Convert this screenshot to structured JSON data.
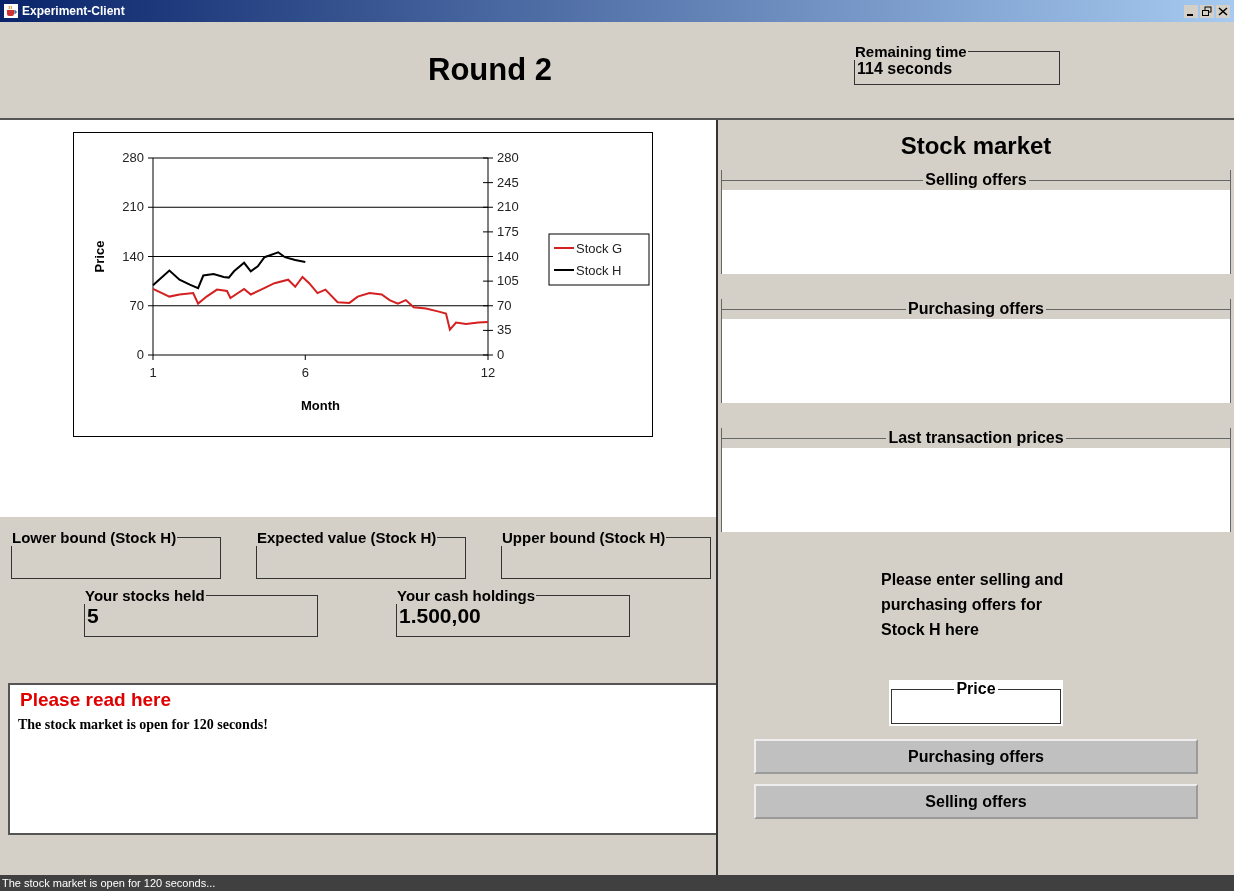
{
  "window": {
    "title": "Experiment-Client"
  },
  "header": {
    "round": "Round 2",
    "remaining_time": {
      "label": "Remaining time",
      "value": "114 seconds"
    }
  },
  "chart_data": {
    "type": "line",
    "xlabel": "Month",
    "ylabel": "Price",
    "xlim": [
      1,
      12
    ],
    "ylim": [
      0,
      280
    ],
    "xticks": [
      1,
      6,
      12
    ],
    "yticks": [
      0,
      70,
      140,
      210,
      280
    ],
    "grid": true,
    "legend": true,
    "annotations": [
      "0",
      "35",
      "70",
      "105",
      "140",
      "175",
      "210",
      "245",
      "280"
    ],
    "series": [
      {
        "name": "Stock G",
        "color": "#d42020",
        "x": [
          1,
          1.54,
          1.87,
          2.32,
          2.48,
          2.76,
          3.1,
          3.43,
          3.54,
          3.99,
          4.21,
          4.55,
          4.99,
          5.44,
          5.67,
          5.91,
          6.13,
          6.4,
          6.66,
          7.06,
          7.45,
          7.72,
          8.11,
          8.51,
          8.77,
          9.04,
          9.3,
          9.56,
          9.96,
          10.35,
          10.62,
          10.75,
          10.95,
          11.28,
          11.68,
          12
        ],
        "values": [
          94,
          83,
          86,
          88,
          73,
          83,
          93,
          91,
          81,
          94,
          86,
          93,
          102,
          107,
          97,
          111,
          102,
          88,
          93,
          75,
          74,
          83,
          88,
          86,
          78,
          73,
          78,
          68,
          66,
          62,
          59,
          36,
          46,
          44,
          46,
          47
        ]
      },
      {
        "name": "Stock H",
        "color": "#000000",
        "x": [
          1,
          1.2,
          1.54,
          1.87,
          2.21,
          2.48,
          2.65,
          2.99,
          3.32,
          3.49,
          3.66,
          3.99,
          4.21,
          4.44,
          4.66,
          5.11,
          5.33,
          5.67,
          6
        ],
        "values": [
          99,
          107,
          120,
          107,
          100,
          95,
          113,
          115,
          111,
          110,
          119,
          131,
          119,
          126,
          139,
          146,
          139,
          135,
          132
        ]
      }
    ]
  },
  "bounds": [
    {
      "label": "Lower bound (Stock H)"
    },
    {
      "label": "Expected value (Stock H)"
    },
    {
      "label": "Upper bound (Stock H)"
    }
  ],
  "holdings": [
    {
      "label": "Your stocks held",
      "value": "5"
    },
    {
      "label": "Your cash holdings",
      "value": "1.500,00"
    }
  ],
  "messages": {
    "heading": "Please read here",
    "text": "The stock market is open for 120 seconds!"
  },
  "market": {
    "title": "Stock market",
    "lists": [
      {
        "title": "Selling offers"
      },
      {
        "title": "Purchasing offers"
      },
      {
        "title": "Last transaction prices"
      }
    ],
    "instruction": "Please enter selling and purchasing offers for Stock H here",
    "price_label": "Price",
    "buttons": [
      "Purchasing offers",
      "Selling offers"
    ]
  },
  "status_bar": "The stock market is open for 120 seconds..."
}
